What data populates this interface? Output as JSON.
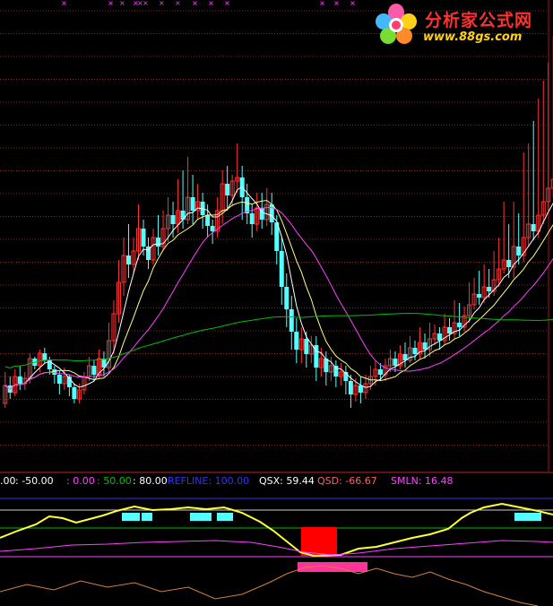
{
  "logo": {
    "name": "分析家公式网",
    "url": "www.88gs.com"
  },
  "colors": {
    "up": "#ff3333",
    "down": "#54ffff",
    "ma_short": "#ffffff",
    "ma_mid": "#ffff80",
    "ma_long": "#ff40ff",
    "ma_very_long": "#00c000",
    "indicator_line": "#ffff33",
    "smln": "#ff40ff",
    "osc": "#d08040",
    "refline": "#3030ff"
  },
  "legend": [
    {
      "text": ".00",
      "color": "#ffffff"
    },
    {
      "text": ": -50.00",
      "color": "#ffffff"
    },
    {
      "text": ": 0.00",
      "color": "#ff40ff"
    },
    {
      "text": ": 50.00",
      "color": "#00c000"
    },
    {
      "text": ": 80.00",
      "color": "#ffffff"
    },
    {
      "text": "REFLINE: 100.00",
      "color": "#3030ff"
    },
    {
      "text": "QSX: 59.44",
      "color": "#ffffff"
    },
    {
      "text": "QSD: -66.67",
      "color": "#ff6060"
    },
    {
      "text": "SMLN: 16.48",
      "color": "#ff40ff"
    }
  ],
  "chart_data": {
    "type": "candlestick",
    "candles": [
      [
        40,
        60,
        35,
        75
      ],
      [
        60,
        52,
        45,
        70
      ],
      [
        52,
        70,
        48,
        78
      ],
      [
        70,
        62,
        55,
        82
      ],
      [
        62,
        68,
        55,
        75
      ],
      [
        68,
        90,
        62,
        96
      ],
      [
        90,
        82,
        78,
        92
      ],
      [
        82,
        96,
        75,
        100
      ],
      [
        96,
        88,
        85,
        102
      ],
      [
        88,
        78,
        72,
        92
      ],
      [
        78,
        72,
        62,
        82
      ],
      [
        72,
        62,
        50,
        76
      ],
      [
        62,
        70,
        55,
        80
      ],
      [
        70,
        58,
        48,
        72
      ],
      [
        58,
        45,
        40,
        62
      ],
      [
        45,
        55,
        40,
        62
      ],
      [
        55,
        70,
        50,
        75
      ],
      [
        70,
        82,
        65,
        92
      ],
      [
        82,
        72,
        65,
        88
      ],
      [
        72,
        90,
        68,
        100
      ],
      [
        90,
        80,
        70,
        98
      ],
      [
        80,
        110,
        75,
        130
      ],
      [
        110,
        140,
        95,
        155
      ],
      [
        140,
        175,
        130,
        200
      ],
      [
        175,
        205,
        160,
        225
      ],
      [
        205,
        195,
        180,
        240
      ],
      [
        195,
        210,
        185,
        225
      ],
      [
        210,
        235,
        200,
        262
      ],
      [
        235,
        215,
        205,
        245
      ],
      [
        215,
        200,
        190,
        225
      ],
      [
        200,
        225,
        195,
        235
      ],
      [
        225,
        215,
        205,
        250
      ],
      [
        215,
        235,
        210,
        255
      ],
      [
        235,
        250,
        220,
        270
      ],
      [
        250,
        240,
        225,
        265
      ],
      [
        240,
        255,
        230,
        290
      ],
      [
        255,
        245,
        235,
        300
      ],
      [
        245,
        270,
        240,
        315
      ],
      [
        270,
        255,
        240,
        295
      ],
      [
        255,
        265,
        245,
        285
      ],
      [
        265,
        250,
        235,
        275
      ],
      [
        250,
        238,
        225,
        262
      ],
      [
        238,
        232,
        218,
        245
      ],
      [
        232,
        255,
        225,
        270
      ],
      [
        255,
        285,
        240,
        300
      ],
      [
        285,
        272,
        255,
        305
      ],
      [
        272,
        288,
        260,
        295
      ],
      [
        288,
        292,
        275,
        330
      ],
      [
        292,
        270,
        245,
        305
      ],
      [
        270,
        252,
        240,
        285
      ],
      [
        252,
        240,
        225,
        262
      ],
      [
        240,
        258,
        232,
        275
      ],
      [
        258,
        245,
        235,
        275
      ],
      [
        245,
        262,
        238,
        280
      ],
      [
        262,
        242,
        228,
        275
      ],
      [
        242,
        210,
        195,
        250
      ],
      [
        210,
        170,
        150,
        225
      ],
      [
        170,
        145,
        125,
        185
      ],
      [
        145,
        120,
        100,
        160
      ],
      [
        120,
        100,
        85,
        135
      ],
      [
        100,
        112,
        85,
        125
      ],
      [
        112,
        95,
        80,
        120
      ],
      [
        95,
        105,
        85,
        115
      ],
      [
        105,
        80,
        65,
        115
      ],
      [
        80,
        90,
        70,
        102
      ],
      [
        90,
        75,
        60,
        98
      ],
      [
        75,
        82,
        65,
        92
      ],
      [
        82,
        70,
        58,
        88
      ],
      [
        70,
        75,
        60,
        85
      ],
      [
        75,
        65,
        50,
        82
      ],
      [
        65,
        50,
        35,
        72
      ],
      [
        50,
        60,
        42,
        68
      ],
      [
        60,
        52,
        40,
        70
      ],
      [
        52,
        62,
        45,
        72
      ],
      [
        62,
        70,
        55,
        82
      ],
      [
        70,
        78,
        60,
        88
      ],
      [
        78,
        72,
        65,
        85
      ],
      [
        72,
        82,
        65,
        90
      ],
      [
        82,
        90,
        75,
        100
      ],
      [
        90,
        82,
        75,
        98
      ],
      [
        82,
        95,
        78,
        105
      ],
      [
        95,
        88,
        80,
        108
      ],
      [
        88,
        102,
        85,
        115
      ],
      [
        102,
        95,
        88,
        110
      ],
      [
        95,
        108,
        90,
        125
      ],
      [
        108,
        100,
        90,
        118
      ],
      [
        100,
        112,
        92,
        130
      ],
      [
        112,
        118,
        105,
        128
      ],
      [
        118,
        110,
        100,
        125
      ],
      [
        110,
        125,
        105,
        140
      ],
      [
        125,
        118,
        110,
        135
      ],
      [
        118,
        130,
        112,
        155
      ],
      [
        130,
        125,
        115,
        152
      ],
      [
        125,
        138,
        120,
        148
      ],
      [
        138,
        150,
        130,
        175
      ],
      [
        150,
        162,
        145,
        180
      ],
      [
        162,
        158,
        150,
        188
      ],
      [
        158,
        170,
        152,
        195
      ],
      [
        170,
        165,
        158,
        190
      ],
      [
        165,
        178,
        160,
        210
      ],
      [
        178,
        190,
        170,
        225
      ],
      [
        190,
        200,
        185,
        265
      ],
      [
        200,
        192,
        180,
        240
      ],
      [
        192,
        215,
        180,
        265
      ],
      [
        215,
        205,
        195,
        252
      ],
      [
        205,
        225,
        198,
        320
      ],
      [
        225,
        240,
        215,
        330
      ],
      [
        240,
        232,
        222,
        355
      ],
      [
        232,
        250,
        225,
        380
      ],
      [
        250,
        265,
        240,
        400
      ],
      [
        265,
        280,
        255,
        420
      ],
      [
        280,
        290,
        270,
        450
      ]
    ],
    "reference_levels": [
      -50,
      0,
      50,
      80,
      100
    ],
    "indicators": {
      "QSX": 59.44,
      "QSD": -66.67,
      "SMLN": 16.48
    }
  }
}
